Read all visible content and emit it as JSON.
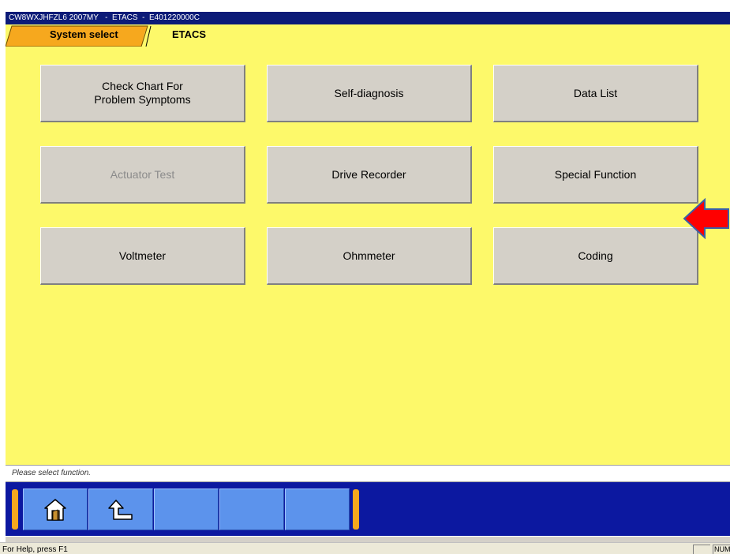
{
  "window": {
    "title": "CW8WXJHFZL6 2007MY   -  ETACS  -  E401220000C"
  },
  "breadcrumb": {
    "items": [
      "System select",
      "ETACS"
    ]
  },
  "functions": {
    "check_chart": "Check Chart For\nProblem Symptoms",
    "self_diagnosis": "Self-diagnosis",
    "data_list": "Data List",
    "actuator_test": "Actuator Test",
    "drive_recorder": "Drive Recorder",
    "special_function": "Special Function",
    "voltmeter": "Voltmeter",
    "ohmmeter": "Ohmmeter",
    "coding": "Coding"
  },
  "message": "Please select function.",
  "toolbar": {
    "icons": [
      "home-icon",
      "up-arrow-icon"
    ]
  },
  "statusbar": {
    "help_text": "For Help, press F1",
    "num_indicator": "NUM"
  },
  "colors": {
    "panel_yellow": "#fdf96a",
    "toolbar_blue": "#0c18a0",
    "title_blue": "#0c1b78",
    "arrow_red": "#ff0000",
    "tab_orange": "#f6a81e"
  }
}
